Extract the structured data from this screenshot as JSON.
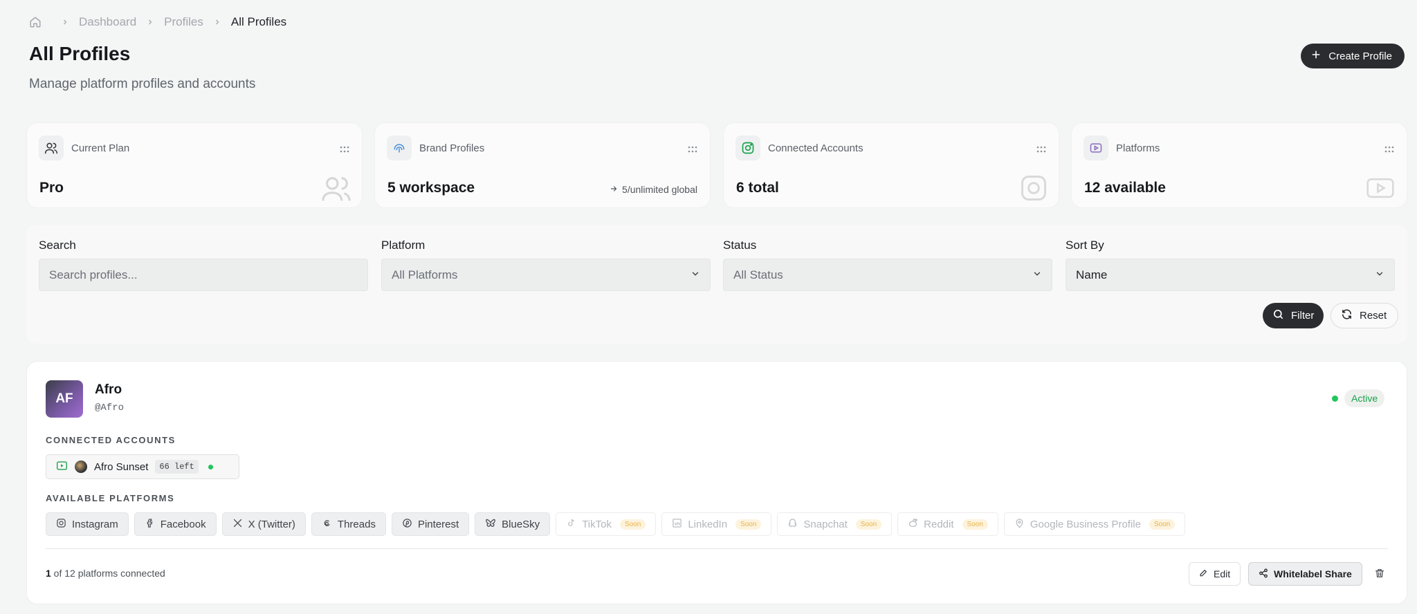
{
  "breadcrumb": {
    "items": [
      "Dashboard",
      "Profiles",
      "All Profiles"
    ]
  },
  "header": {
    "title": "All Profiles",
    "subtitle": "Manage platform profiles and accounts",
    "create_button": "Create Profile"
  },
  "stats": [
    {
      "label": "Current Plan",
      "value": "Pro",
      "icon": "users-icon"
    },
    {
      "label": "Brand Profiles",
      "value": "5 workspace",
      "note": "5/unlimited global",
      "icon": "fingerprint-icon"
    },
    {
      "label": "Connected Accounts",
      "value": "6 total",
      "icon": "instagram-icon"
    },
    {
      "label": "Platforms",
      "value": "12 available",
      "icon": "youtube-icon"
    }
  ],
  "filters": {
    "search": {
      "label": "Search",
      "placeholder": "Search profiles..."
    },
    "platform": {
      "label": "Platform",
      "value": "All Platforms"
    },
    "status": {
      "label": "Status",
      "value": "All Status"
    },
    "sort": {
      "label": "Sort By",
      "value": "Name"
    },
    "filter_button": "Filter",
    "reset_button": "Reset"
  },
  "profile": {
    "initials": "AF",
    "name": "Afro",
    "handle": "@Afro",
    "status": "Active",
    "status_color": "#22c55e",
    "connected_title": "CONNECTED ACCOUNTS",
    "account": {
      "name": "Afro Sunset",
      "left": "66 left"
    },
    "available_title": "AVAILABLE PLATFORMS",
    "platforms": [
      {
        "name": "Instagram",
        "soon": false
      },
      {
        "name": "Facebook",
        "soon": false
      },
      {
        "name": "X (Twitter)",
        "soon": false
      },
      {
        "name": "Threads",
        "soon": false
      },
      {
        "name": "Pinterest",
        "soon": false
      },
      {
        "name": "BlueSky",
        "soon": false
      },
      {
        "name": "TikTok",
        "soon": true
      },
      {
        "name": "LinkedIn",
        "soon": true
      },
      {
        "name": "Snapchat",
        "soon": true
      },
      {
        "name": "Reddit",
        "soon": true
      },
      {
        "name": "Google Business Profile",
        "soon": true
      }
    ],
    "soon_label": "Soon",
    "connected_count": "1",
    "connected_suffix": " of 12 platforms connected",
    "edit_button": "Edit",
    "share_button": "Whitelabel Share"
  }
}
